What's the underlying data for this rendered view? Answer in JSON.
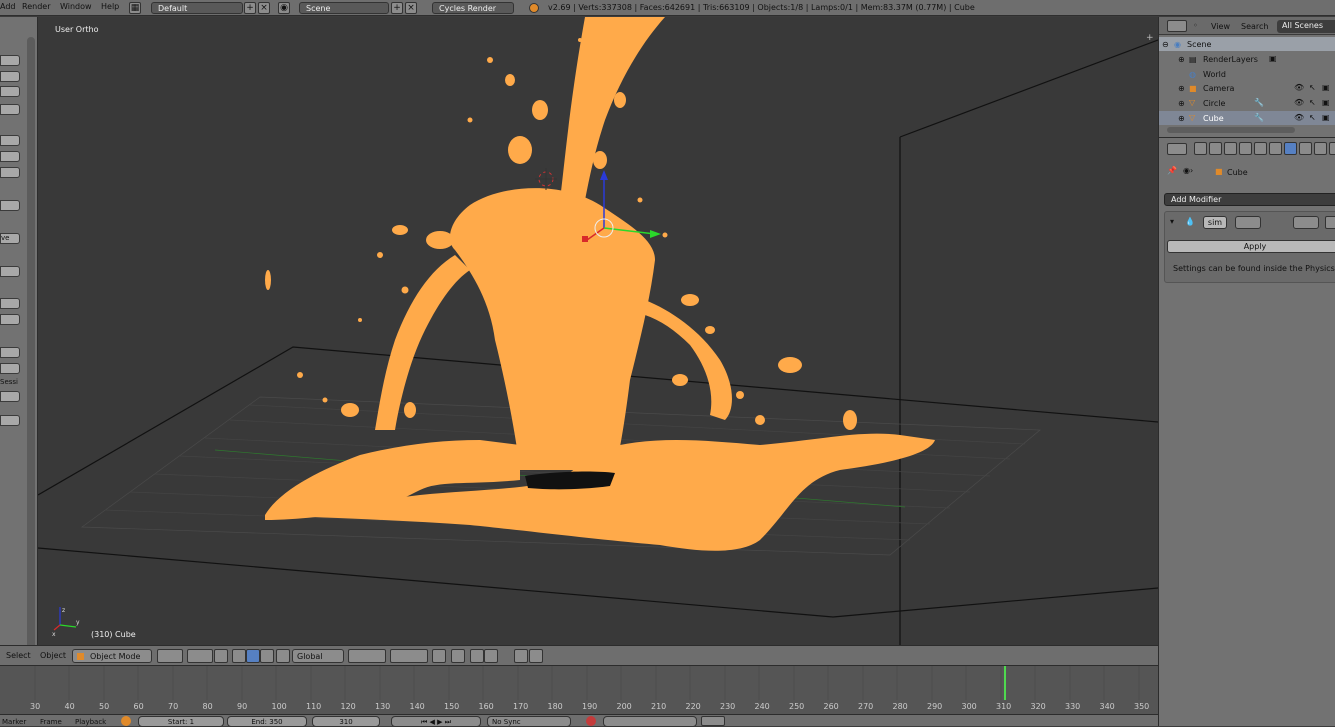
{
  "topbar": {
    "menus": [
      "Add",
      "Render",
      "Window",
      "Help"
    ],
    "screen_layout": "Default",
    "scene": "Scene",
    "render_engine": "Cycles Render",
    "stats": "v2.69 | Verts:337308 | Faces:642691 | Tris:663109 | Objects:1/8 | Lamps:0/1 | Mem:83.37M (0.77M) | Cube"
  },
  "viewport": {
    "view_label": "User Ortho",
    "object_label": "(310) Cube",
    "fluid_color": "#ffaa4a",
    "background_color": "#393939"
  },
  "viewport_header": {
    "select": "Select",
    "object": "Object",
    "mode": "Object Mode",
    "orientation": "Global"
  },
  "toolshelf": {
    "partial_labels": [
      "ve",
      "Sessi"
    ]
  },
  "timeline": {
    "ticks": [
      "30",
      "40",
      "50",
      "60",
      "70",
      "80",
      "90",
      "100",
      "110",
      "120",
      "130",
      "140",
      "150",
      "160",
      "170",
      "180",
      "190",
      "200",
      "210",
      "220",
      "230",
      "240",
      "250",
      "260",
      "270",
      "280",
      "290",
      "300",
      "310",
      "320",
      "330",
      "340",
      "350"
    ],
    "current_frame_marker": "310",
    "current_frame_color": "#4fd84f"
  },
  "bottombar": {
    "marker": "Marker",
    "frame": "Frame",
    "playback": "Playback",
    "start": "Start: 1",
    "end": "End: 350",
    "current": "310",
    "sync": "No Sync"
  },
  "outliner": {
    "view": "View",
    "search": "Search",
    "filter": "All Scenes",
    "items": [
      {
        "label": "Scene",
        "level": 0
      },
      {
        "label": "RenderLayers",
        "level": 1
      },
      {
        "label": "World",
        "level": 1
      },
      {
        "label": "Camera",
        "level": 1
      },
      {
        "label": "Circle",
        "level": 1
      },
      {
        "label": "Cube",
        "level": 1
      }
    ]
  },
  "properties": {
    "context_object": "Cube",
    "add_modifier": "Add Modifier",
    "modifier_name": "sim",
    "apply": "Apply",
    "info_text": "Settings can be found inside the Physics con"
  }
}
